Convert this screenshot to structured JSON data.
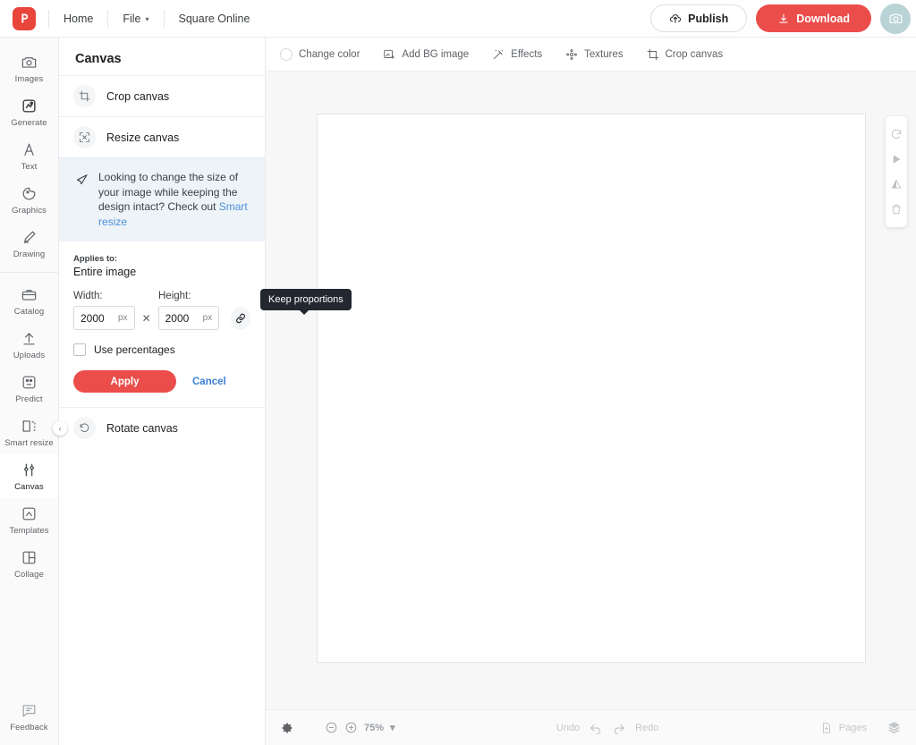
{
  "topbar": {
    "logo_icon": "picsart-logo-icon",
    "nav": [
      {
        "label": "Home",
        "icon": ""
      },
      {
        "label": "File",
        "icon": "chevron-down-icon",
        "caret": "▾"
      },
      {
        "label": "Square Online",
        "icon": ""
      }
    ],
    "publish_label": "Publish",
    "publish_icon": "publish-cloud-icon",
    "download_label": "Download",
    "download_icon": "download-icon",
    "camera_icon": "camera-icon",
    "accent_red": "#eb4d4b",
    "camera_bg": "#b9d3d6"
  },
  "rail": {
    "items": [
      {
        "label": "Images",
        "icon": "camera-icon",
        "active": false
      },
      {
        "label": "Generate",
        "icon": "ai-generate-icon",
        "active": false
      },
      {
        "label": "Text",
        "icon": "text-a-icon",
        "active": false
      },
      {
        "label": "Graphics",
        "icon": "graphics-sticker-icon",
        "active": false
      },
      {
        "label": "Drawing",
        "icon": "pencil-draw-icon",
        "active": false
      },
      {
        "label": "Catalog",
        "icon": "catalog-box-icon",
        "active": false
      },
      {
        "label": "Uploads",
        "icon": "upload-arrow-icon",
        "active": false
      },
      {
        "label": "Predict",
        "icon": "predict-icon",
        "active": false
      },
      {
        "label": "Smart resize",
        "icon": "smart-resize-icon",
        "active": false
      },
      {
        "label": "Canvas",
        "icon": "canvas-sliders-icon",
        "active": true
      },
      {
        "label": "Templates",
        "icon": "templates-icon",
        "active": false
      },
      {
        "label": "Collage",
        "icon": "collage-grid-icon",
        "active": false
      }
    ],
    "feedback": {
      "label": "Feedback",
      "icon": "feedback-chat-icon"
    }
  },
  "panel": {
    "title": "Canvas",
    "crop": {
      "label": "Crop canvas",
      "icon": "crop-icon"
    },
    "resize": {
      "label": "Resize canvas",
      "icon": "resize-icon"
    },
    "notice": {
      "icon": "megaphone-icon",
      "text": "Looking to change the size of your image while keeping the design intact? Check out ",
      "link": "Smart resize"
    },
    "applies_label": "Applies to:",
    "applies_value": "Entire image",
    "width_label": "Width:",
    "height_label": "Height:",
    "width_value": "2000",
    "height_value": "2000",
    "width_unit": "px",
    "height_unit": "px",
    "times": "✕",
    "link_icon": "chain-link-icon",
    "tooltip": "Keep proportions",
    "percentages_label": "Use percentages",
    "apply_label": "Apply",
    "cancel_label": "Cancel",
    "rotate": {
      "label": "Rotate canvas",
      "icon": "rotate-icon"
    },
    "collapse_icon": "chevron-left-icon",
    "collapse_glyph": "‹"
  },
  "canvas_toolbar": {
    "items": [
      {
        "label": "Change color",
        "icon": "color-circle-icon"
      },
      {
        "label": "Add BG image",
        "icon": "add-image-icon"
      },
      {
        "label": "Effects",
        "icon": "effects-sparkle-icon"
      },
      {
        "label": "Textures",
        "icon": "textures-icon"
      },
      {
        "label": "Crop canvas",
        "icon": "crop-icon"
      }
    ]
  },
  "float_tools": [
    {
      "icon": "undo-rotate-icon"
    },
    {
      "icon": "flip-horizontal-icon"
    },
    {
      "icon": "flip-vertical-icon"
    },
    {
      "icon": "trash-delete-icon"
    }
  ],
  "bottombar": {
    "settings_icon": "gear-icon",
    "zoom_out_icon": "zoom-out-icon",
    "zoom_in_icon": "zoom-in-icon",
    "zoom_value": "75%",
    "zoom_caret": "▾",
    "undo_label": "Undo",
    "undo_icon": "undo-arrow-icon",
    "redo_icon": "redo-arrow-icon",
    "redo_label": "Redo",
    "pages_label": "Pages",
    "pages_icon": "add-page-icon",
    "layers_icon": "layers-icon"
  }
}
